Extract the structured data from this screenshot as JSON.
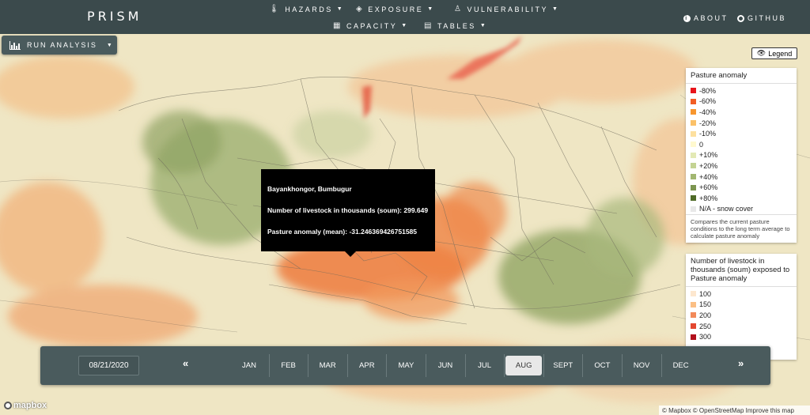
{
  "app": {
    "brand": "PRISM"
  },
  "nav": {
    "hazards": "HAZARDS",
    "exposure": "EXPOSURE",
    "vulnerability": "VULNERABILITY",
    "capacity": "CAPACITY",
    "tables": "TABLES",
    "about": "ABOUT",
    "github": "GITHUB"
  },
  "run_analysis": {
    "label": "RUN ANALYSIS"
  },
  "legend_button": {
    "label": "Legend"
  },
  "legend_pasture": {
    "title": "Pasture anomaly",
    "items": [
      {
        "label": "-80%",
        "color": "#e8141b"
      },
      {
        "label": "-60%",
        "color": "#f25d24"
      },
      {
        "label": "-40%",
        "color": "#f7962e"
      },
      {
        "label": "-20%",
        "color": "#fbc168"
      },
      {
        "label": "-10%",
        "color": "#fde09f"
      },
      {
        "label": "0",
        "color": "#fff9cf"
      },
      {
        "label": "+10%",
        "color": "#e3e9b5"
      },
      {
        "label": "+20%",
        "color": "#c4d393"
      },
      {
        "label": "+40%",
        "color": "#a2b771"
      },
      {
        "label": "+60%",
        "color": "#7c9550"
      },
      {
        "label": "+80%",
        "color": "#4f6b27"
      },
      {
        "label": "N/A - snow cover",
        "color": "#e8e8e8"
      }
    ],
    "description": "Compares the current pasture conditions to the long term average to calculate pasture anomaly"
  },
  "legend_livestock": {
    "title": "Number of livestock in thousands (soum) exposed to Pasture anomaly",
    "items": [
      {
        "label": "100",
        "color": "#fde7cf"
      },
      {
        "label": "150",
        "color": "#fbbf85"
      },
      {
        "label": "200",
        "color": "#f28a5a"
      },
      {
        "label": "250",
        "color": "#e3472f"
      },
      {
        "label": "300",
        "color": "#b2101c"
      }
    ]
  },
  "tooltip": {
    "title": "Bayankhongor, Bumbugur",
    "livestock": "Number of livestock in thousands (soum): 299.649",
    "anomaly": "Pasture anomaly (mean): -31.246369426751585"
  },
  "timeline": {
    "date": "08/21/2020",
    "prev": "«",
    "next": "»",
    "months": [
      "JAN",
      "FEB",
      "MAR",
      "APR",
      "MAY",
      "JUN",
      "JUL",
      "AUG",
      "SEPT",
      "OCT",
      "NOV",
      "DEC"
    ],
    "active_month": "AUG"
  },
  "footer": {
    "mapbox_logo": "mapbox",
    "attribution": "© Mapbox © OpenStreetMap Improve this map"
  },
  "colors": {
    "navbar": "#3b4a4c",
    "panel": "#4a5b5d",
    "anomaly_negative": "#f07a35",
    "anomaly_positive": "#8fa363"
  }
}
